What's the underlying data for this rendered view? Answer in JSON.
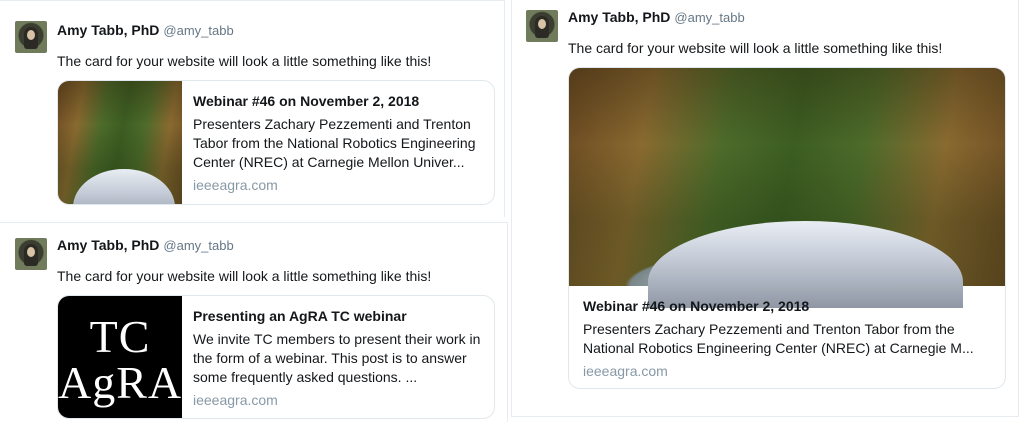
{
  "tweets": [
    {
      "author": {
        "name": "Amy Tabb, PhD",
        "handle": "@amy_tabb"
      },
      "text": "The card for your website will look a little something like this!",
      "card": {
        "layout": "summary",
        "image": "car-in-orchard-photo",
        "title": "Webinar #46 on November 2, 2018",
        "description": "Presenters Zachary Pezzementi and Trenton Tabor from the National Robotics Engineering Center (NREC) at Carnegie Mellon Univer...",
        "domain": "ieeeagra.com"
      }
    },
    {
      "author": {
        "name": "Amy Tabb, PhD",
        "handle": "@amy_tabb"
      },
      "text": "The card for your website will look a little something like this!",
      "card": {
        "layout": "summary",
        "image": "tc-agra-logo",
        "logo_lines": [
          "TC",
          "AgRA"
        ],
        "title": "Presenting an AgRA TC webinar",
        "description": "We invite TC members to present their work in the form of a webinar.  This post is to answer some frequently asked questions.  ...",
        "domain": "ieeeagra.com"
      }
    },
    {
      "author": {
        "name": "Amy Tabb, PhD",
        "handle": "@amy_tabb"
      },
      "text": "The card for your website will look a little something like this!",
      "card": {
        "layout": "summary_large_image",
        "image": "car-in-orchard-photo",
        "title": "Webinar #46 on November 2, 2018",
        "description": "Presenters Zachary Pezzementi and Trenton Tabor from the National Robotics Engineering Center (NREC) at Carnegie M...",
        "domain": "ieeeagra.com"
      }
    }
  ],
  "colors": {
    "text": "#14171a",
    "muted": "#657786",
    "domain": "#8899a6",
    "border": "#e1e8ed"
  }
}
